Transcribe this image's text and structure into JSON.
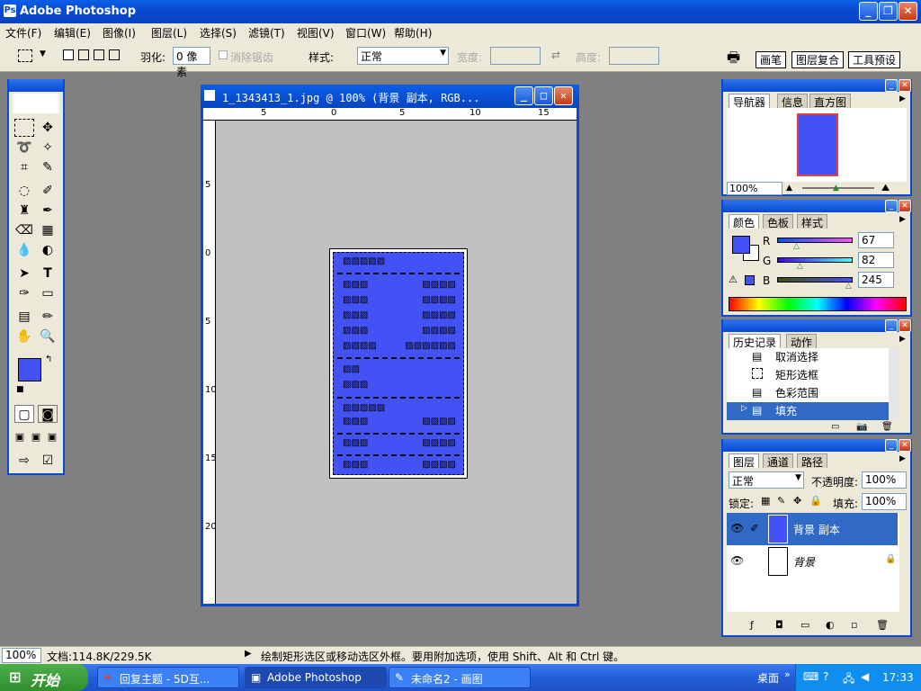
{
  "app": {
    "title": "Adobe Photoshop"
  },
  "menu": [
    "文件(F)",
    "编辑(E)",
    "图像(I)",
    "图层(L)",
    "选择(S)",
    "滤镜(T)",
    "视图(V)",
    "窗口(W)",
    "帮助(H)"
  ],
  "options": {
    "feather_label": "羽化:",
    "feather_value": "0 像素",
    "antialias_label": "消除锯齿",
    "style_label": "样式:",
    "style_value": "正常",
    "width_label": "宽度:",
    "height_label": "高度:",
    "right_tabs": [
      "画笔",
      "图层复合",
      "工具预设"
    ]
  },
  "document": {
    "title": "1_1343413_1.jpg @ 100% (背景 副本, RGB...",
    "ruler_h": [
      "5",
      "0",
      "5",
      "10",
      "15"
    ],
    "ruler_v": [
      "0",
      "5",
      "0",
      "5",
      "10",
      "15",
      "20"
    ]
  },
  "navigator": {
    "tabs": [
      "导航器",
      "信息",
      "直方图"
    ],
    "zoom": "100%"
  },
  "color": {
    "tabs": [
      "颜色",
      "色板",
      "样式"
    ],
    "r_label": "R",
    "r_value": "67",
    "g_label": "G",
    "g_value": "82",
    "b_label": "B",
    "b_value": "245",
    "fg_color": "#4352f5"
  },
  "history": {
    "tabs": [
      "历史记录",
      "动作"
    ],
    "items": [
      "取消选择",
      "矩形选框",
      "色彩范围",
      "填充"
    ]
  },
  "layers": {
    "tabs": [
      "图层",
      "通道",
      "路径"
    ],
    "blend_mode": "正常",
    "opacity_label": "不透明度:",
    "opacity_value": "100%",
    "lock_label": "锁定:",
    "fill_label": "填充:",
    "fill_value": "100%",
    "items": [
      "背景 副本",
      "背景"
    ]
  },
  "status": {
    "zoom": "100%",
    "doc_info": "文档:114.8K/229.5K",
    "hint": "绘制矩形选区或移动选区外框。要用附加选项，使用 Shift、Alt 和 Ctrl 键。"
  },
  "taskbar": {
    "start": "开始",
    "tasks": [
      "回复主题 - 5D互...",
      "Adobe Photoshop",
      "未命名2 - 画图"
    ],
    "desktop": "桌面",
    "clock": "17:33"
  },
  "colors": {
    "xp_blue": "#0a4ad0",
    "fill_blue": "#4352f5",
    "panel_bg": "#ece9d8"
  }
}
